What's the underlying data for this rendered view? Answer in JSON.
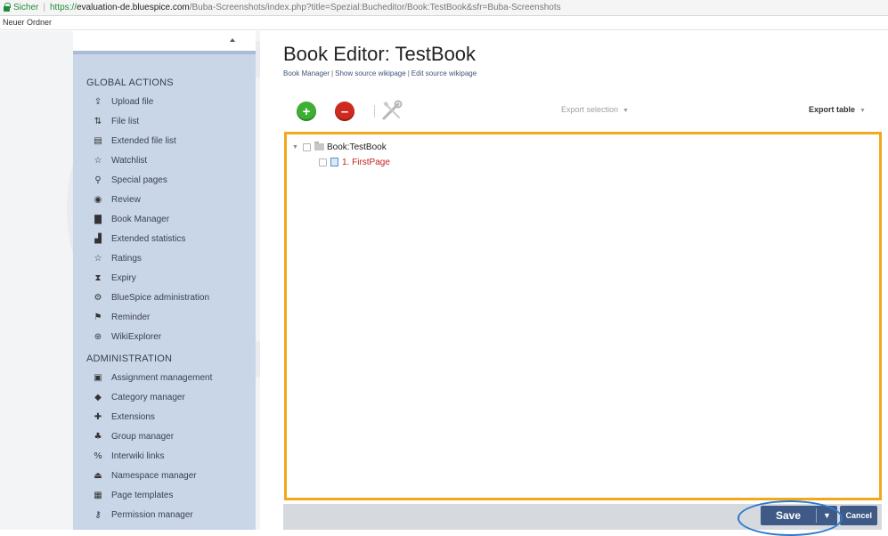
{
  "browser": {
    "secure_label": "Sicher",
    "url_scheme": "https://",
    "url_host": "evaluation-de.bluespice.com",
    "url_path": "/Buba-Screenshots/index.php?title=Spezial:Bucheditor/Book:TestBook&sfr=Buba-Screenshots",
    "bookmark": "Neuer Ordner"
  },
  "sidebar": {
    "global_title": "GLOBAL ACTIONS",
    "global_items": [
      {
        "label": "Upload file",
        "icon": "upload-icon"
      },
      {
        "label": "File list",
        "icon": "sort-icon"
      },
      {
        "label": "Extended file list",
        "icon": "list-box-icon"
      },
      {
        "label": "Watchlist",
        "icon": "star-icon"
      },
      {
        "label": "Special pages",
        "icon": "special-icon"
      },
      {
        "label": "Review",
        "icon": "eye-icon"
      },
      {
        "label": "Book Manager",
        "icon": "book-icon"
      },
      {
        "label": "Extended statistics",
        "icon": "chart-icon"
      },
      {
        "label": "Ratings",
        "icon": "star-icon"
      },
      {
        "label": "Expiry",
        "icon": "hourglass-icon"
      },
      {
        "label": "BlueSpice administration",
        "icon": "gear-icon"
      },
      {
        "label": "Reminder",
        "icon": "flag-icon"
      },
      {
        "label": "WikiExplorer",
        "icon": "compass-icon"
      }
    ],
    "admin_title": "ADMINISTRATION",
    "admin_items": [
      {
        "label": "Assignment management",
        "icon": "assignment-icon"
      },
      {
        "label": "Category manager",
        "icon": "tag-icon"
      },
      {
        "label": "Extensions",
        "icon": "puzzle-icon"
      },
      {
        "label": "Group manager",
        "icon": "group-icon"
      },
      {
        "label": "Interwiki links",
        "icon": "link-icon"
      },
      {
        "label": "Namespace manager",
        "icon": "namespace-icon"
      },
      {
        "label": "Page templates",
        "icon": "template-icon"
      },
      {
        "label": "Permission manager",
        "icon": "key-icon"
      }
    ]
  },
  "main": {
    "title": "Book Editor: TestBook",
    "links": [
      "Book Manager",
      "Show source wikipage",
      "Edit source wikipage"
    ],
    "toolbar": {
      "add_symbol": "+",
      "remove_symbol": "–",
      "export_selection": "Export selection",
      "export_table": "Export table"
    },
    "tree": {
      "book": "Book:TestBook",
      "pages": [
        "1. FirstPage"
      ]
    },
    "footer": {
      "save": "Save",
      "cancel": "Cancel"
    }
  },
  "colors": {
    "tree_border": "#f2a81d",
    "save_button": "#3f5a86",
    "highlight": "#2c79cc",
    "page_link": "#c02222"
  }
}
